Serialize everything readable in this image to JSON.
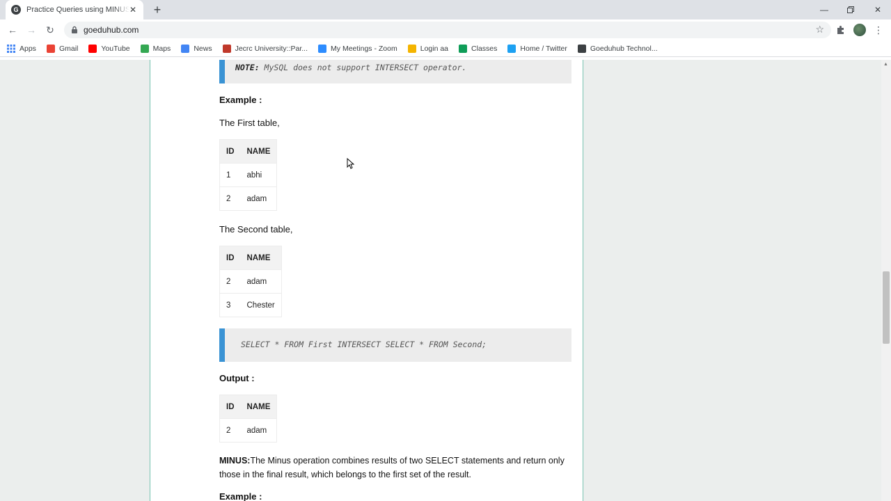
{
  "browser": {
    "tab_title": "Practice Queries using MINUS, UNION",
    "tab_favicon_letter": "G",
    "url": "goeduhub.com",
    "bookmarks": [
      {
        "label": "Apps",
        "icon": "apps-grid-icon",
        "color": "#4285f4"
      },
      {
        "label": "Gmail",
        "icon": "gmail-icon",
        "color": "#ea4335"
      },
      {
        "label": "YouTube",
        "icon": "youtube-icon",
        "color": "#ff0000"
      },
      {
        "label": "Maps",
        "icon": "maps-icon",
        "color": "#34a853"
      },
      {
        "label": "News",
        "icon": "news-icon",
        "color": "#4285f4"
      },
      {
        "label": "Jecrc University::Par...",
        "icon": "jecrc-icon",
        "color": "#c0392b"
      },
      {
        "label": "My Meetings - Zoom",
        "icon": "zoom-icon",
        "color": "#2d8cff"
      },
      {
        "label": "Login aa",
        "icon": "login-icon",
        "color": "#f4b400"
      },
      {
        "label": "Classes",
        "icon": "classes-icon",
        "color": "#0f9d58"
      },
      {
        "label": "Home / Twitter",
        "icon": "twitter-icon",
        "color": "#1da1f2"
      },
      {
        "label": "Goeduhub Technol...",
        "icon": "goeduhub-icon",
        "color": "#3c4043"
      }
    ]
  },
  "article": {
    "note_label": "NOTE:",
    "note_text": " MySQL does not support INTERSECT operator.",
    "example_heading": "Example :",
    "first_table_caption": "The First table,",
    "first_table": {
      "headers": [
        "ID",
        "NAME"
      ],
      "rows": [
        [
          "1",
          "abhi"
        ],
        [
          "2",
          "adam"
        ]
      ]
    },
    "second_table_caption": "The Second table,",
    "second_table": {
      "headers": [
        "ID",
        "NAME"
      ],
      "rows": [
        [
          "2",
          "adam"
        ],
        [
          "3",
          "Chester"
        ]
      ]
    },
    "query": "SELECT * FROM First INTERSECT SELECT * FROM Second;",
    "output_heading": "Output :",
    "output_table": {
      "headers": [
        "ID",
        "NAME"
      ],
      "rows": [
        [
          "2",
          "adam"
        ]
      ]
    },
    "minus_label": "MINUS:",
    "minus_text": "The Minus operation combines results of two SELECT statements and return only those in the final result, which belongs to the first set of the result.",
    "next_heading": "Example :"
  }
}
